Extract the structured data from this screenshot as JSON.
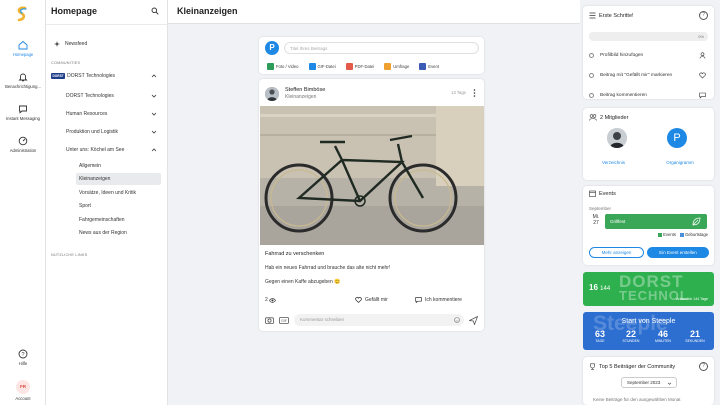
{
  "rail": {
    "items": [
      {
        "label": "Homepage",
        "icon": "home-icon"
      },
      {
        "label": "Benachrichtigung...",
        "icon": "bell-icon"
      },
      {
        "label": "Instant Messaging",
        "icon": "chat-icon"
      },
      {
        "label": "Administration",
        "icon": "gauge-icon"
      }
    ],
    "help": "Hilfe",
    "account_initials": "FR",
    "account": "Account"
  },
  "nav": {
    "title": "Homepage",
    "newsfeed": "Newsfeed",
    "section_communities": "COMMUNITIES",
    "brand_badge": "DORST",
    "community_root": "DORST Technologies",
    "items": [
      "DORST Technologies",
      "Human Resources",
      "Produktion und Logistik",
      "Unter uns: Köchel am See"
    ],
    "subitems": [
      "Allgemein",
      "Kleinanzeigen",
      "Vorsätze, Ideen und Kritik",
      "Sport",
      "Fahrgemeinschaften",
      "News aus der Region"
    ],
    "section_links": "NÜTZLICHE LINKS"
  },
  "header": {
    "title": "Kleinanzeigen"
  },
  "composer": {
    "avatar": "P",
    "placeholder": "Titel Ihres Beitrags",
    "tools": [
      "Foto / Video",
      "GIF-Datei",
      "PDF-Datei",
      "Umfrage",
      "Event"
    ]
  },
  "post": {
    "author": "Steffen Bimböse",
    "channel": "Kleinanzeigen",
    "time": "13 Tage",
    "title": "Fahrrad zu verschenken",
    "text1": "Hab ein neues Fahrrad und brauche das alte nicht mehr!",
    "text2": "Gegen einen Kaffe abzugeben 😊",
    "views": "2",
    "like": "Gefällt mir",
    "comment": "Ich kommentiere",
    "comment_placeholder": "Kommentar schreiben"
  },
  "first_steps": {
    "title": "Erste Schritte!",
    "progress": "0%",
    "progress_value": 0,
    "steps": [
      "Profilbild hinzufügen",
      "Beitrag mit \"Gefällt mir\" markieren",
      "Beitrag kommentieren"
    ]
  },
  "members": {
    "title": "2 Mitglieder",
    "avatar2": "P",
    "directory": "Verzeichnis",
    "orgchart": "Organigramm"
  },
  "events": {
    "title": "Events",
    "month": "September",
    "day_name": "Mi.",
    "day_num": "27",
    "event_name": "Grillfest",
    "legend_events": "Events",
    "legend_birthdays": "Geburtstage",
    "show": "Mehr anzeigen",
    "create": "Ein Event erstellen",
    "colors": {
      "events": "#3aa657",
      "birthdays": "#4a90d9"
    }
  },
  "banner_green": {
    "days": "16",
    "hours": "144",
    "bg_text1": "DORST",
    "bg_text2": "TECHNOL",
    "caption": "Anlässlich 144 Tage"
  },
  "banner_blue": {
    "bg_text": "Steeple",
    "title": "Start von Steeple",
    "counts": [
      {
        "n": "63",
        "l": "TAGE"
      },
      {
        "n": "22",
        "l": "STUNDEN"
      },
      {
        "n": "46",
        "l": "MINUTEN"
      },
      {
        "n": "21",
        "l": "SEKUNDEN"
      }
    ]
  },
  "top5": {
    "title": "Top 5 Beiträger der Community",
    "select": "September 2023",
    "note": "Keine Beiträge für den ausgewählten Monat"
  }
}
